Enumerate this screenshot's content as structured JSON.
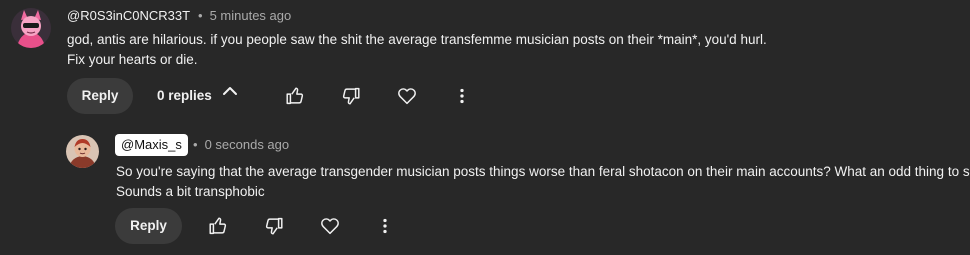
{
  "comment": {
    "author": "@R0S3inC0NCR33T",
    "separator": "•",
    "time": "5 minutes ago",
    "text_line1": "god, antis are hilarious. if you people saw the shit the average transfemme musician posts on their *main*, you'd hurl.",
    "text_line2": "Fix your hearts or die.",
    "reply_label": "Reply",
    "replies_label": "0 replies"
  },
  "reply": {
    "author": "@Maxis_s",
    "separator": "•",
    "time": "0 seconds ago",
    "text_line1": "So you're saying that the average transgender musician posts things worse than feral shotacon on their main accounts? What an odd thing to say.",
    "text_line2": "Sounds a bit transphobic",
    "reply_label": "Reply"
  },
  "icons": {
    "like": "thumbs-up-icon",
    "dislike": "thumbs-down-icon",
    "heart": "heart-icon",
    "more": "more-vertical-icon",
    "chevron": "chevron-up-icon"
  },
  "colors": {
    "background": "#282828",
    "text": "#f1f1f1",
    "muted": "#aaaaaa",
    "button_bg": "#3b3b3b"
  }
}
